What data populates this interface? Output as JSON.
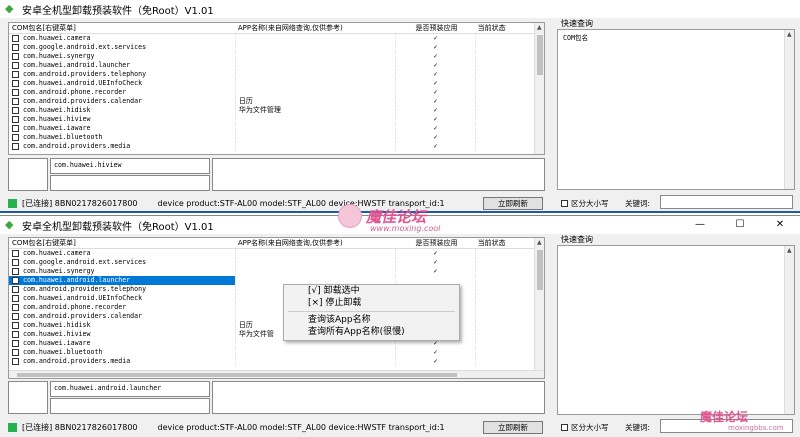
{
  "window1": {
    "title": "安卓全机型卸载预装软件（免Root）V1.01",
    "columns": [
      "COM包名[右键菜单]",
      "APP名称(来自网络查询,仅供参考)",
      "是否预装应用",
      "当前状态"
    ],
    "rows": [
      {
        "pkg": "com.huawei.camera",
        "app": "",
        "pre": "✓"
      },
      {
        "pkg": "com.google.android.ext.services",
        "app": "",
        "pre": "✓"
      },
      {
        "pkg": "com.huawei.synergy",
        "app": "",
        "pre": "✓"
      },
      {
        "pkg": "com.huawei.android.launcher",
        "app": "",
        "pre": "✓"
      },
      {
        "pkg": "com.android.providers.telephony",
        "app": "",
        "pre": "✓"
      },
      {
        "pkg": "com.huawei.android.UEInfoCheck",
        "app": "",
        "pre": "✓"
      },
      {
        "pkg": "com.android.phone.recorder",
        "app": "",
        "pre": "✓"
      },
      {
        "pkg": "com.android.providers.calendar",
        "app": "日历",
        "pre": "✓"
      },
      {
        "pkg": "com.huawei.hidisk",
        "app": "华为文件管理",
        "pre": "✓"
      },
      {
        "pkg": "com.huawei.hiview",
        "app": "",
        "pre": "✓"
      },
      {
        "pkg": "com.huawei.iaware",
        "app": "",
        "pre": "✓"
      },
      {
        "pkg": "com.huawei.bluetooth",
        "app": "",
        "pre": "✓"
      },
      {
        "pkg": "com.android.providers.media",
        "app": "",
        "pre": "✓"
      }
    ],
    "info_pkg": "com.huawei.hiview",
    "status_connected": "[已连接] 8BN0217826017800",
    "device_info": "device product:STF-AL00 model:STF_AL00 device:HWSTF transport_id:1",
    "refresh_button": "立即刷新",
    "quick_query_title": "快速查询",
    "quick_query_col": "COM包名",
    "case_label": "区分大小写",
    "keyword_label": "关键词:"
  },
  "window2": {
    "title": "安卓全机型卸载预装软件（免Root）V1.01",
    "win_min": "—",
    "win_max": "☐",
    "win_close": "✕",
    "columns": [
      "COM包名[右键菜单]",
      "APP名称(来自网络查询,仅供参考)",
      "是否预装应用",
      "当前状态"
    ],
    "rows": [
      {
        "pkg": "com.huawei.camera",
        "app": "",
        "pre": "✓"
      },
      {
        "pkg": "com.google.android.ext.services",
        "app": "",
        "pre": "✓"
      },
      {
        "pkg": "com.huawei.synergy",
        "app": "",
        "pre": "✓"
      },
      {
        "pkg": "com.huawei.android.launcher",
        "app": "",
        "pre": ""
      },
      {
        "pkg": "com.android.providers.telephony",
        "app": "",
        "pre": ""
      },
      {
        "pkg": "com.huawei.android.UEInfoCheck",
        "app": "",
        "pre": ""
      },
      {
        "pkg": "com.android.phone.recorder",
        "app": "",
        "pre": ""
      },
      {
        "pkg": "com.android.providers.calendar",
        "app": "",
        "pre": ""
      },
      {
        "pkg": "com.huawei.hidisk",
        "app": "日历",
        "pre": "✓"
      },
      {
        "pkg": "com.huawei.hiview",
        "app": "华为文件管",
        "pre": "✓"
      },
      {
        "pkg": "com.huawei.iaware",
        "app": "",
        "pre": "✓"
      },
      {
        "pkg": "com.huawei.bluetooth",
        "app": "",
        "pre": "✓"
      },
      {
        "pkg": "com.android.providers.media",
        "app": "",
        "pre": "✓"
      }
    ],
    "selected_index": 3,
    "info_pkg": "com.huawei.android.launcher",
    "status_connected": "[已连接] 8BN0217826017800",
    "device_info": "device product:STF-AL00 model:STF_AL00 device:HWSTF transport_id:1",
    "refresh_button": "立即刷新",
    "quick_query_title": "快速查询",
    "case_label": "区分大小写",
    "keyword_label": "关键词:"
  },
  "context_menu": {
    "items": [
      "[√] 卸载选中",
      "[×] 停止卸载",
      "查询该App名称",
      "查询所有App名称(很慢)"
    ]
  },
  "watermark": {
    "brand": "魔佳论坛",
    "url": "www.moxing.cool",
    "brand2": "魔佳论坛",
    "url2": "moxingbbs.com"
  },
  "colors": {
    "selection": "#0078d7",
    "led": "#22b14c",
    "accent_border": "#1e5aa8"
  }
}
